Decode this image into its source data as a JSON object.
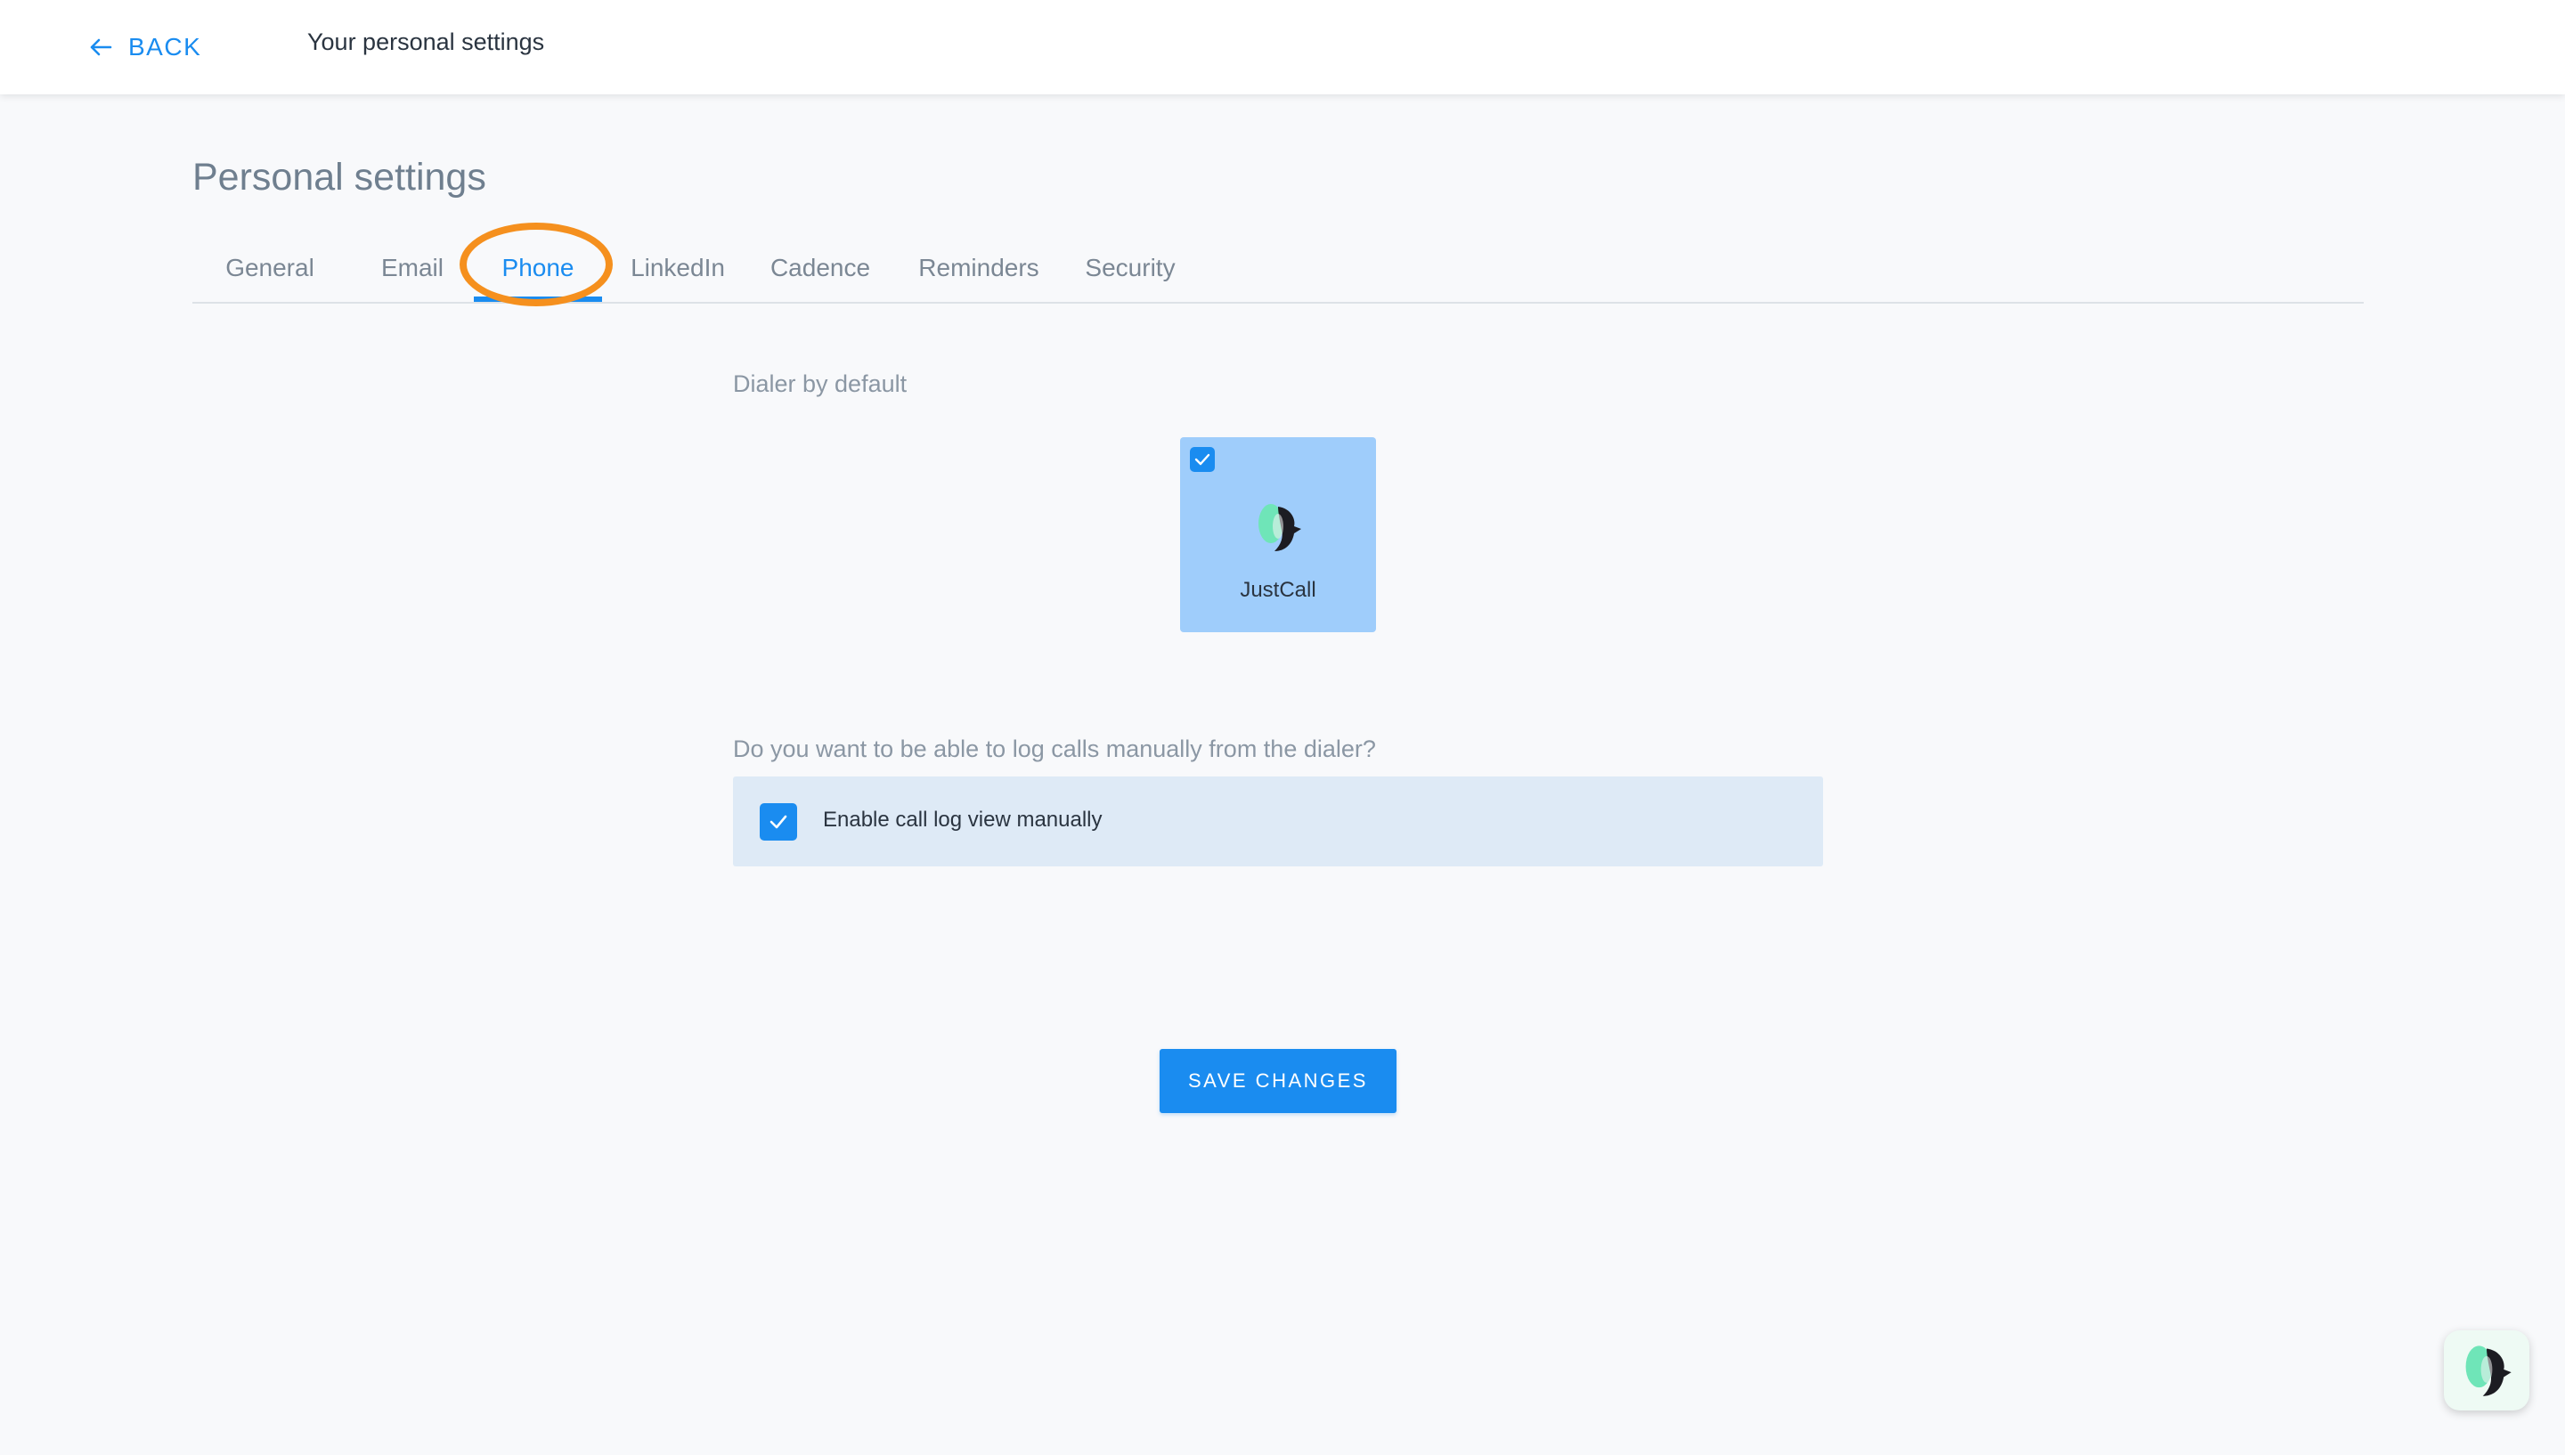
{
  "header": {
    "back_label": "BACK",
    "title": "Your personal settings"
  },
  "page": {
    "heading": "Personal settings"
  },
  "tabs": [
    {
      "label": "General",
      "active": false
    },
    {
      "label": "Email",
      "active": false
    },
    {
      "label": "Phone",
      "active": true
    },
    {
      "label": "LinkedIn",
      "active": false
    },
    {
      "label": "Cadence",
      "active": false
    },
    {
      "label": "Reminders",
      "active": false
    },
    {
      "label": "Security",
      "active": false
    }
  ],
  "dialer": {
    "section_label": "Dialer by default",
    "selected_option": {
      "name": "JustCall",
      "checked": true,
      "icon": "justcall-logo-icon"
    }
  },
  "call_log": {
    "question": "Do you want to be able to log calls manually from the dialer?",
    "option_label": "Enable call log view manually",
    "checked": true
  },
  "actions": {
    "save_label": "SAVE CHANGES"
  },
  "colors": {
    "accent": "#1a8cf0",
    "highlight_ring": "#f5901e",
    "card_selected": "#9fcdfb",
    "option_background": "#deeaf6"
  },
  "icons": {
    "back": "arrow-left-icon",
    "check": "checkmark-icon",
    "fab": "justcall-logo-icon"
  }
}
